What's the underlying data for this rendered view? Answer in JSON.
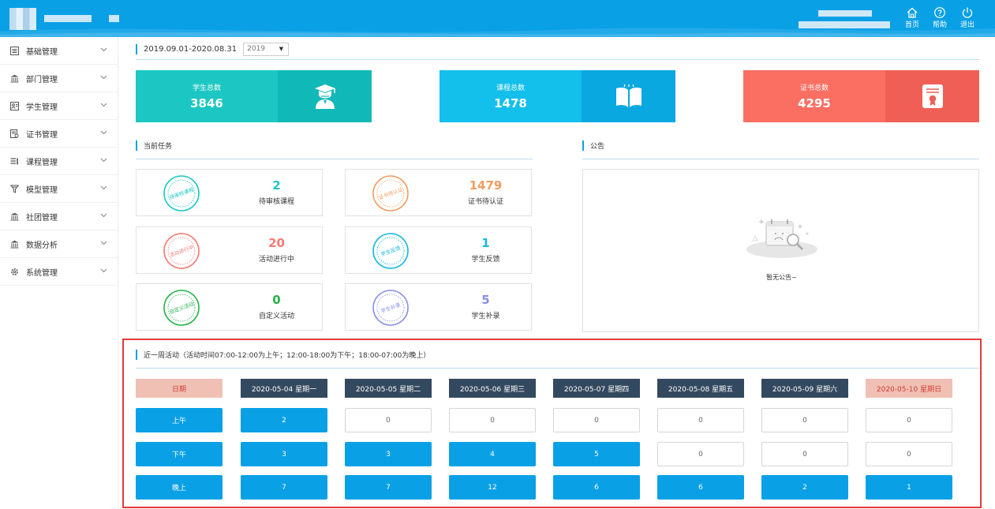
{
  "header": {
    "buttons": [
      {
        "name": "home",
        "label": "首页"
      },
      {
        "name": "help",
        "label": "帮助"
      },
      {
        "name": "logout",
        "label": "退出"
      }
    ]
  },
  "sidebar": {
    "items": [
      {
        "label": "基础管理",
        "icon": "list-icon"
      },
      {
        "label": "部门管理",
        "icon": "bank-icon"
      },
      {
        "label": "学生管理",
        "icon": "student-card-icon"
      },
      {
        "label": "证书管理",
        "icon": "certificate-icon"
      },
      {
        "label": "课程管理",
        "icon": "course-list-icon"
      },
      {
        "label": "模型管理",
        "icon": "funnel-icon"
      },
      {
        "label": "社团管理",
        "icon": "bank-icon"
      },
      {
        "label": "数据分析",
        "icon": "bank-icon"
      },
      {
        "label": "系统管理",
        "icon": "gear-icon"
      }
    ]
  },
  "period": {
    "range": "2019.09.01-2020.08.31",
    "year_selected": "2019"
  },
  "stats": [
    {
      "title": "学生总数",
      "value": "3846",
      "color": "#1cc7c3",
      "icon_bg": "#10b9b7",
      "icon": "graduate-icon"
    },
    {
      "title": "课程总数",
      "value": "1478",
      "color": "#13bfeb",
      "icon_bg": "#0aa8e0",
      "icon": "book-icon"
    },
    {
      "title": "证书总数",
      "value": "4295",
      "color": "#fb6f62",
      "icon_bg": "#ef5f55",
      "icon": "certificate-icon"
    }
  ],
  "tasks": {
    "title": "当前任务",
    "items": [
      {
        "value": "2",
        "label": "待审核课程",
        "stamp": "待审核课程",
        "color": "#1cc7c3"
      },
      {
        "value": "1479",
        "label": "证书待认证",
        "stamp": "证书待认证",
        "color": "#f29d5e"
      },
      {
        "value": "20",
        "label": "活动进行中",
        "stamp": "活动进行中",
        "color": "#f27c74"
      },
      {
        "value": "1",
        "label": "学生反馈",
        "stamp": "学生反馈",
        "color": "#14b9e0"
      },
      {
        "value": "0",
        "label": "自定义活动",
        "stamp": "自定义活动",
        "color": "#27b34a"
      },
      {
        "value": "5",
        "label": "学生补录",
        "stamp": "学生补录",
        "color": "#8890e8"
      }
    ]
  },
  "notice": {
    "title": "公告",
    "empty_text": "暂无公告~"
  },
  "activity": {
    "title": "近一周活动（活动时间07:00-12:00为上午；12:00-18:00为下午；18:00-07:00为晚上）",
    "date_header": "日期",
    "days": [
      "2020-05-04 星期一",
      "2020-05-05 星期二",
      "2020-05-06 星期三",
      "2020-05-07 星期四",
      "2020-05-08 星期五",
      "2020-05-09 星期六",
      "2020-05-10 星期日"
    ],
    "rows": [
      {
        "label": "上午",
        "values": [
          "2",
          "0",
          "0",
          "0",
          "0",
          "0",
          "0"
        ]
      },
      {
        "label": "下午",
        "values": [
          "3",
          "3",
          "4",
          "5",
          "0",
          "0",
          "0"
        ]
      },
      {
        "label": "晚上",
        "values": [
          "7",
          "7",
          "12",
          "6",
          "6",
          "2",
          "1"
        ]
      }
    ]
  }
}
